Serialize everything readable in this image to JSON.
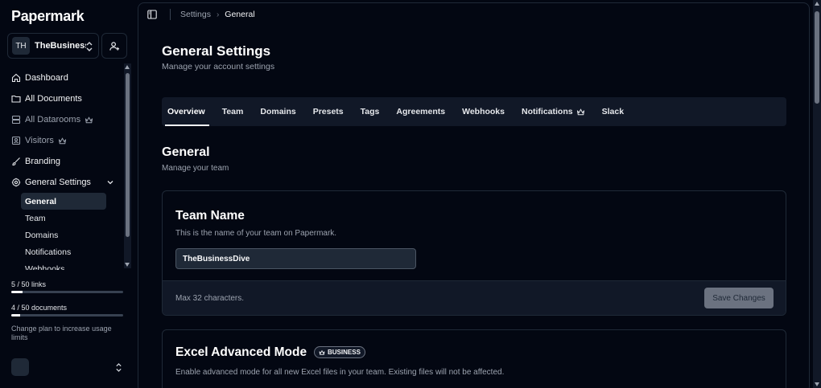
{
  "app": {
    "name": "Papermark"
  },
  "team_switcher": {
    "initials": "TH",
    "name": "TheBusiness..."
  },
  "sidebar": {
    "items": [
      {
        "label": "Dashboard",
        "icon": "home-icon"
      },
      {
        "label": "All Documents",
        "icon": "folder-icon"
      },
      {
        "label": "All Datarooms",
        "icon": "server-icon",
        "premium": true
      },
      {
        "label": "Visitors",
        "icon": "contact-icon",
        "premium": true
      },
      {
        "label": "Branding",
        "icon": "brush-icon"
      },
      {
        "label": "General Settings",
        "icon": "cog-icon",
        "expanded": true
      }
    ],
    "sub_items": [
      {
        "label": "General",
        "active": true
      },
      {
        "label": "Team"
      },
      {
        "label": "Domains"
      },
      {
        "label": "Notifications"
      },
      {
        "label": "Webhooks"
      }
    ]
  },
  "usage": {
    "links_label": "5 / 50 links",
    "links_fraction": 0.1,
    "documents_label": "4 / 50 documents",
    "documents_fraction": 0.08,
    "upgrade_note": "Change plan to increase usage limits"
  },
  "breadcrumb": {
    "parent": "Settings",
    "separator": "›",
    "current": "General"
  },
  "page": {
    "title": "General Settings",
    "subtitle": "Manage your account settings"
  },
  "tabs": [
    {
      "label": "Overview",
      "active": true
    },
    {
      "label": "Team"
    },
    {
      "label": "Domains"
    },
    {
      "label": "Presets"
    },
    {
      "label": "Tags"
    },
    {
      "label": "Agreements"
    },
    {
      "label": "Webhooks"
    },
    {
      "label": "Notifications",
      "premium": true
    },
    {
      "label": "Slack"
    }
  ],
  "section": {
    "title": "General",
    "subtitle": "Manage your team"
  },
  "team_name_card": {
    "title": "Team Name",
    "description": "This is the name of your team on Papermark.",
    "input_value": "TheBusinessDive",
    "footer_note": "Max 32 characters.",
    "save_label": "Save Changes"
  },
  "excel_card": {
    "title": "Excel Advanced Mode",
    "badge": "BUSINESS",
    "description": "Enable advanced mode for all new Excel files in your team. Existing files will not be affected."
  },
  "colors": {
    "background": "#030712",
    "panel": "#111827",
    "border": "#1f2937",
    "muted_text": "#9ca3af"
  }
}
